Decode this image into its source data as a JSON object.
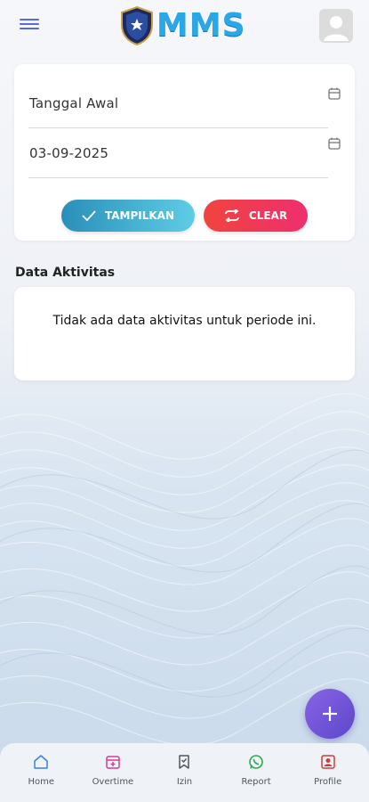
{
  "header": {
    "logo_text": "MMS"
  },
  "filter": {
    "start_date_label": "Tanggal Awal",
    "end_date_value": "03-09-2025",
    "show_button": "TAMPILKAN",
    "clear_button": "CLEAR"
  },
  "activities": {
    "title": "Data Aktivitas",
    "empty_message": "Tidak ada data aktivitas untuk periode ini."
  },
  "nav": {
    "items": [
      {
        "label": "Home",
        "icon": "home-icon"
      },
      {
        "label": "Overtime",
        "icon": "calendar-plus-icon"
      },
      {
        "label": "Izin",
        "icon": "bookmark-check-icon"
      },
      {
        "label": "Report",
        "icon": "whatsapp-icon"
      },
      {
        "label": "Profile",
        "icon": "profile-card-icon"
      }
    ]
  },
  "colors": {
    "accent": "#5b6bd5",
    "show_button": "#2a8fb8",
    "clear_button": "#f0443e",
    "fab": "#6a50d6"
  }
}
